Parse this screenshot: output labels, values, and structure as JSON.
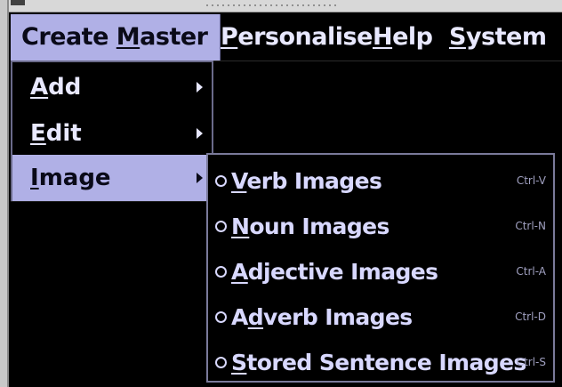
{
  "menubar": {
    "items": [
      {
        "label_pre": "Create ",
        "label_u": "M",
        "label_post": "aster"
      },
      {
        "label_pre": "",
        "label_u": "P",
        "label_post": "ersonalise"
      },
      {
        "label_pre": "",
        "label_u": "H",
        "label_post": "elp"
      },
      {
        "label_pre": "",
        "label_u": "S",
        "label_post": "ystem"
      }
    ]
  },
  "dropdown": {
    "items": [
      {
        "label_u": "A",
        "label_post": "dd"
      },
      {
        "label_u": "E",
        "label_post": "dit"
      },
      {
        "label_u": "I",
        "label_post": "mage"
      }
    ],
    "active": "Image"
  },
  "submenu": {
    "items": [
      {
        "label_pre": "",
        "label_u": "V",
        "label_post": "erb Images",
        "shortcut": "Ctrl-V"
      },
      {
        "label_pre": "",
        "label_u": "N",
        "label_post": "oun Images",
        "shortcut": "Ctrl-N"
      },
      {
        "label_pre": "",
        "label_u": "A",
        "label_post": "djective Images",
        "shortcut": "Ctrl-A"
      },
      {
        "label_pre": "A",
        "label_u": "d",
        "label_post": "verb Images",
        "shortcut": "Ctrl-D"
      },
      {
        "label_pre": "",
        "label_u": "S",
        "label_post": "tored Sentence Images",
        "shortcut": "Ctrl-S"
      }
    ]
  },
  "colors": {
    "highlight": "#b0b0e6",
    "background": "#000000",
    "text": "#e8e8ff"
  }
}
